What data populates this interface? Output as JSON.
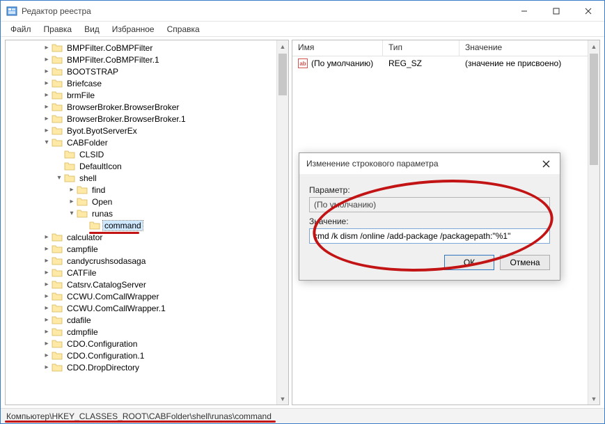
{
  "window": {
    "title": "Редактор реестра"
  },
  "menu": {
    "file": "Файл",
    "edit": "Правка",
    "view": "Вид",
    "favorites": "Избранное",
    "help": "Справка"
  },
  "tree": {
    "items": [
      {
        "label": "BMPFilter.CoBMPFilter",
        "depth": 2,
        "exp": ">"
      },
      {
        "label": "BMPFilter.CoBMPFilter.1",
        "depth": 2,
        "exp": ">"
      },
      {
        "label": "BOOTSTRAP",
        "depth": 2,
        "exp": ">"
      },
      {
        "label": "Briefcase",
        "depth": 2,
        "exp": ">"
      },
      {
        "label": "brmFile",
        "depth": 2,
        "exp": ">"
      },
      {
        "label": "BrowserBroker.BrowserBroker",
        "depth": 2,
        "exp": ">"
      },
      {
        "label": "BrowserBroker.BrowserBroker.1",
        "depth": 2,
        "exp": ">"
      },
      {
        "label": "Byot.ByotServerEx",
        "depth": 2,
        "exp": ">"
      },
      {
        "label": "CABFolder",
        "depth": 2,
        "exp": "v"
      },
      {
        "label": "CLSID",
        "depth": 3,
        "exp": " "
      },
      {
        "label": "DefaultIcon",
        "depth": 3,
        "exp": " "
      },
      {
        "label": "shell",
        "depth": 3,
        "exp": "v"
      },
      {
        "label": "find",
        "depth": 4,
        "exp": ">"
      },
      {
        "label": "Open",
        "depth": 4,
        "exp": ">"
      },
      {
        "label": "runas",
        "depth": 4,
        "exp": "v"
      },
      {
        "label": "command",
        "depth": 5,
        "exp": " ",
        "selected": true
      },
      {
        "label": "calculator",
        "depth": 2,
        "exp": ">"
      },
      {
        "label": "campfile",
        "depth": 2,
        "exp": ">"
      },
      {
        "label": "candycrushsodasaga",
        "depth": 2,
        "exp": ">"
      },
      {
        "label": "CATFile",
        "depth": 2,
        "exp": ">"
      },
      {
        "label": "Catsrv.CatalogServer",
        "depth": 2,
        "exp": ">"
      },
      {
        "label": "CCWU.ComCallWrapper",
        "depth": 2,
        "exp": ">"
      },
      {
        "label": "CCWU.ComCallWrapper.1",
        "depth": 2,
        "exp": ">"
      },
      {
        "label": "cdafile",
        "depth": 2,
        "exp": ">"
      },
      {
        "label": "cdmpfile",
        "depth": 2,
        "exp": ">"
      },
      {
        "label": "CDO.Configuration",
        "depth": 2,
        "exp": ">"
      },
      {
        "label": "CDO.Configuration.1",
        "depth": 2,
        "exp": ">"
      },
      {
        "label": "CDO.DropDirectory",
        "depth": 2,
        "exp": ">"
      }
    ]
  },
  "list": {
    "columns": {
      "name": "Имя",
      "type": "Тип",
      "data": "Значение"
    },
    "row": {
      "name": "(По умолчанию)",
      "type": "REG_SZ",
      "data": "(значение не присвоено)"
    }
  },
  "dialog": {
    "title": "Изменение строкового параметра",
    "param_label": "Параметр:",
    "param_value": "(По умолчанию)",
    "value_label": "Значение:",
    "value_input": "cmd /k dism /online /add-package /packagepath:\"%1\"",
    "ok": "ОК",
    "cancel": "Отмена"
  },
  "status": {
    "path": "Компьютер\\HKEY_CLASSES_ROOT\\CABFolder\\shell\\runas\\command"
  }
}
